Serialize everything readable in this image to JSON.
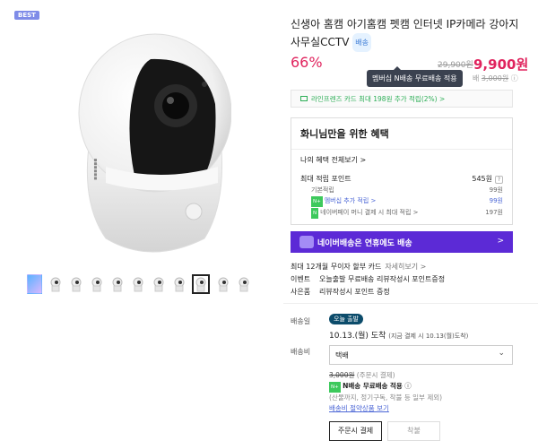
{
  "badge": "BEST",
  "product": {
    "title": "신생아 홈캠 아기홈캠 펫캠 인터넷 IP카메라 강아지 사무실CCTV",
    "bb_badge": "배송",
    "discount": "66%",
    "original_price": "29,900원",
    "sale_price": "9,900원",
    "membership_tooltip": "멤버십 N배송 무료배송 적용",
    "shipping_strike": "3,000원",
    "shipping_prefix": "배"
  },
  "card_banner": "라인프렌즈 카드 최대 198원 추가 적립(2%) >",
  "benefits": {
    "title": "화니님만을 위한 혜택",
    "view_all": "나의 혜택 전체보기 >",
    "max_points_label": "최대 적립 포인트",
    "max_points_value": "545원",
    "base_label": "기본적립",
    "base_value": "99원",
    "membership_label": "멤버십 추가 적립 >",
    "membership_value": "99원",
    "naverpay_label": "네이버페이 머니 결제 시 최대 적립 >",
    "naverpay_value": "197원"
  },
  "purple_banner": "네이버배송은 연휴에도 배송",
  "purple_arrow": ">",
  "info": {
    "installment_label": "최대 12개월 무이자 할부 카드",
    "installment_more": "자세히보기 >",
    "event_label": "이벤트",
    "event_value": "오늘출발 무료배송 리뷰작성시 포인트증정",
    "gift_label": "사은품",
    "gift_value": "리뷰작성시 포인트 증정"
  },
  "shipping": {
    "date_label": "배송일",
    "today_badge": "오늘 출발",
    "arrive": "10.13.(월) 도착",
    "arrive_note": "(지금 결제 시 10.13(월)도착)",
    "fee_label": "배송비",
    "select_value": "택배",
    "fee_strike": "3,000원",
    "fee_cond": "(주문시 결제)",
    "n_free": "N배송 무료배송 적용",
    "exclusions": "(산물까지, 정기구독, 착불 등 일부 제외)",
    "saving_link": "배송비 절약상품 보기"
  },
  "buttons": {
    "pay_on_order": "주문시 결제",
    "cod": "착불"
  },
  "colors": {
    "accent": "#e0245e",
    "purple": "#5c2ad6",
    "green": "#2cae56"
  }
}
